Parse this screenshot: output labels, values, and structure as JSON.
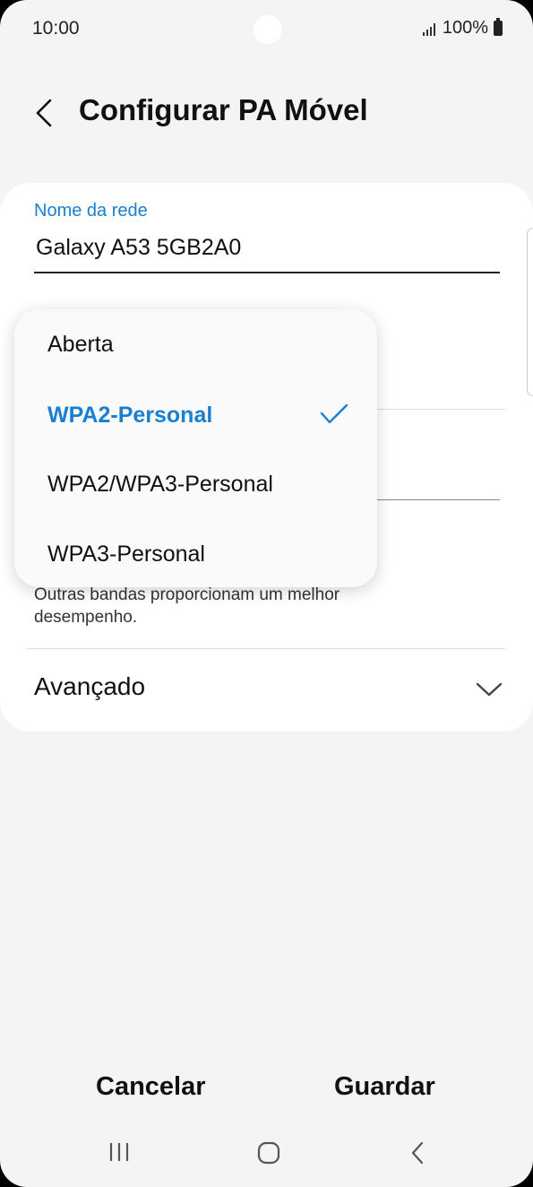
{
  "status_bar": {
    "time": "10:00",
    "battery": "100%"
  },
  "header": {
    "title": "Configurar PA Móvel"
  },
  "network_name": {
    "label": "Nome da rede",
    "value": "Galaxy A53 5GB2A0"
  },
  "security_dropdown": {
    "options": [
      "Aberta",
      "WPA2-Personal",
      "WPA2/WPA3-Personal",
      "WPA3-Personal"
    ],
    "selected": "WPA2-Personal"
  },
  "band": {
    "description": "Outras bandas proporcionam um melhor desempenho."
  },
  "advanced": {
    "label": "Avançado"
  },
  "footer": {
    "cancel_label": "Cancelar",
    "save_label": "Guardar"
  },
  "colors": {
    "accent": "#1a7fd1",
    "background": "#f4f4f4",
    "card": "#ffffff"
  },
  "icons": [
    "back-icon",
    "check-icon",
    "chevron-down-icon",
    "signal-icon",
    "battery-icon",
    "nav-recents-icon",
    "nav-home-icon",
    "nav-back-icon"
  ]
}
